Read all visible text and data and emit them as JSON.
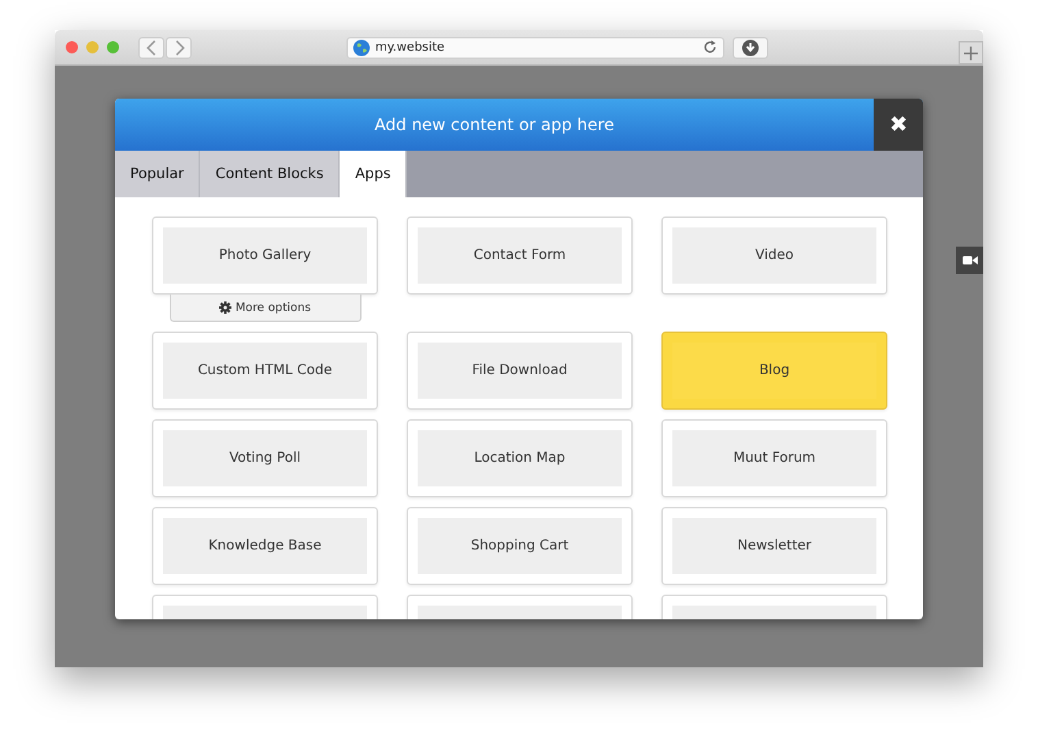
{
  "browser": {
    "address": "my.website"
  },
  "modal": {
    "title": "Add new content or app here",
    "close": "✖"
  },
  "tabs": [
    {
      "label": "Popular",
      "selected": false
    },
    {
      "label": "Content Blocks",
      "selected": false
    },
    {
      "label": "Apps",
      "selected": true
    }
  ],
  "tiles": [
    {
      "kind": "app",
      "label": "Photo Gallery",
      "highlighted": false,
      "options": "More options"
    },
    {
      "kind": "app",
      "label": "Contact Form",
      "highlighted": false
    },
    {
      "kind": "app",
      "label": "Video",
      "highlighted": false
    },
    {
      "kind": "app",
      "label": "Custom HTML Code",
      "highlighted": false
    },
    {
      "kind": "app",
      "label": "File Download",
      "highlighted": false
    },
    {
      "kind": "app",
      "label": "Blog",
      "highlighted": true
    },
    {
      "kind": "app",
      "label": "Voting Poll",
      "highlighted": false
    },
    {
      "kind": "app",
      "label": "Location Map",
      "highlighted": false
    },
    {
      "kind": "app",
      "label": "Muut Forum",
      "highlighted": false
    },
    {
      "kind": "app",
      "label": "Knowledge Base",
      "highlighted": false
    },
    {
      "kind": "app",
      "label": "Shopping Cart",
      "highlighted": false
    },
    {
      "kind": "app",
      "label": "Newsletter",
      "highlighted": false
    },
    {
      "kind": "cut"
    },
    {
      "kind": "cut"
    },
    {
      "kind": "cut"
    }
  ]
}
